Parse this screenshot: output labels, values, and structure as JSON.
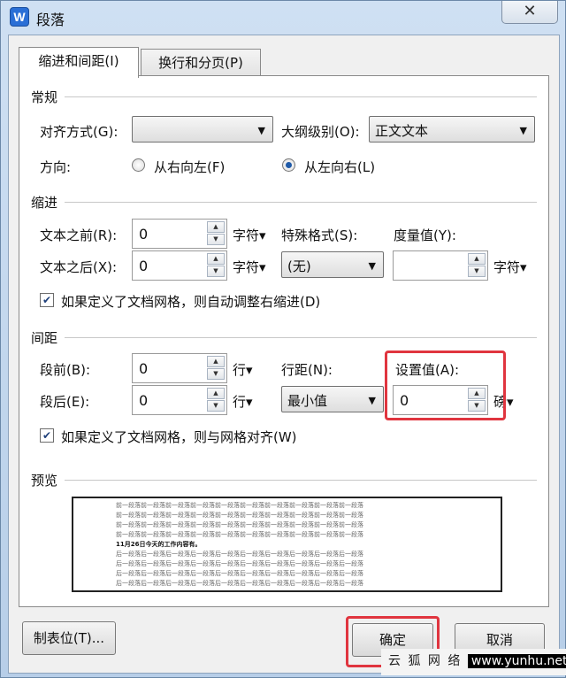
{
  "window": {
    "title": "段落",
    "app_icon_letter": "W",
    "close_glyph": "✕"
  },
  "tabs": [
    {
      "label": "缩进和间距(I)",
      "active": true
    },
    {
      "label": "换行和分页(P)",
      "active": false
    }
  ],
  "general": {
    "group_label": "常规",
    "alignment_label": "对齐方式(G):",
    "alignment_value": "",
    "outline_label": "大纲级别(O):",
    "outline_value": "正文文本",
    "direction_label": "方向:",
    "rtl_label": "从右向左(F)",
    "ltr_label": "从左向右(L)",
    "selected_direction": "ltr"
  },
  "indent": {
    "group_label": "缩进",
    "before_label": "文本之前(R):",
    "before_value": "0",
    "before_unit": "字符▾",
    "after_label": "文本之后(X):",
    "after_value": "0",
    "after_unit": "字符▾",
    "special_label": "特殊格式(S):",
    "special_value": "(无)",
    "measure_label": "度量值(Y):",
    "measure_value": "",
    "measure_unit": "字符▾",
    "auto_adjust_label": "如果定义了文档网格，则自动调整右缩进(D)",
    "auto_adjust_checked": true
  },
  "spacing": {
    "group_label": "间距",
    "before_label": "段前(B):",
    "before_value": "0",
    "before_unit": "行▾",
    "after_label": "段后(E):",
    "after_value": "0",
    "after_unit": "行▾",
    "line_label": "行距(N):",
    "line_value": "最小值",
    "setting_label": "设置值(A):",
    "setting_value": "0",
    "setting_unit": "磅▾",
    "snap_grid_label": "如果定义了文档网格，则与网格对齐(W)",
    "snap_grid_checked": true
  },
  "preview": {
    "group_label": "预览",
    "prev_lines": [
      "前一段落前一段落前一段落前一段落前一段落前一段落前一段落前一段落前一段落前一段落",
      "前一段落前一段落前一段落前一段落前一段落前一段落前一段落前一段落前一段落前一段落",
      "前一段落前一段落前一段落前一段落前一段落前一段落前一段落前一段落前一段落前一段落",
      "前一段落前一段落前一段落前一段落前一段落前一段落前一段落前一段落前一段落前一段落"
    ],
    "sample_line": "11月26日今天的工作内容有。",
    "next_lines": [
      "后一段落后一段落后一段落后一段落后一段落后一段落后一段落后一段落后一段落后一段落",
      "后一段落后一段落后一段落后一段落后一段落后一段落后一段落后一段落后一段落后一段落",
      "后一段落后一段落后一段落后一段落后一段落后一段落后一段落后一段落后一段落后一段落",
      "后一段落后一段落后一段落后一段落后一段落后一段落后一段落后一段落后一段落后一段落"
    ]
  },
  "buttons": {
    "tabs": "制表位(T)...",
    "ok": "确定",
    "cancel": "取消"
  },
  "watermark": {
    "name": "云 狐 网 络",
    "url": "www.yunhu.net"
  },
  "colors": {
    "highlight": "#e0353f",
    "accent": "#1f5aa8"
  }
}
